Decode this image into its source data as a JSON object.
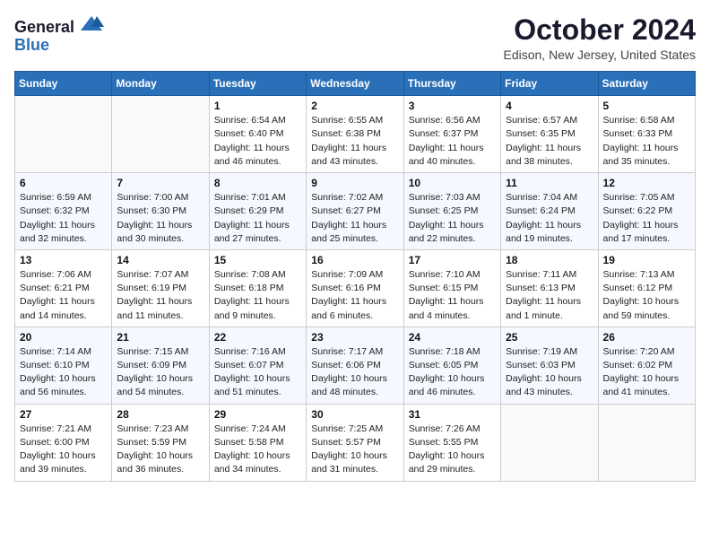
{
  "header": {
    "logo_general": "General",
    "logo_blue": "Blue",
    "month": "October 2024",
    "location": "Edison, New Jersey, United States"
  },
  "days_of_week": [
    "Sunday",
    "Monday",
    "Tuesday",
    "Wednesday",
    "Thursday",
    "Friday",
    "Saturday"
  ],
  "weeks": [
    [
      {
        "day": "",
        "detail": ""
      },
      {
        "day": "",
        "detail": ""
      },
      {
        "day": "1",
        "detail": "Sunrise: 6:54 AM\nSunset: 6:40 PM\nDaylight: 11 hours and 46 minutes."
      },
      {
        "day": "2",
        "detail": "Sunrise: 6:55 AM\nSunset: 6:38 PM\nDaylight: 11 hours and 43 minutes."
      },
      {
        "day": "3",
        "detail": "Sunrise: 6:56 AM\nSunset: 6:37 PM\nDaylight: 11 hours and 40 minutes."
      },
      {
        "day": "4",
        "detail": "Sunrise: 6:57 AM\nSunset: 6:35 PM\nDaylight: 11 hours and 38 minutes."
      },
      {
        "day": "5",
        "detail": "Sunrise: 6:58 AM\nSunset: 6:33 PM\nDaylight: 11 hours and 35 minutes."
      }
    ],
    [
      {
        "day": "6",
        "detail": "Sunrise: 6:59 AM\nSunset: 6:32 PM\nDaylight: 11 hours and 32 minutes."
      },
      {
        "day": "7",
        "detail": "Sunrise: 7:00 AM\nSunset: 6:30 PM\nDaylight: 11 hours and 30 minutes."
      },
      {
        "day": "8",
        "detail": "Sunrise: 7:01 AM\nSunset: 6:29 PM\nDaylight: 11 hours and 27 minutes."
      },
      {
        "day": "9",
        "detail": "Sunrise: 7:02 AM\nSunset: 6:27 PM\nDaylight: 11 hours and 25 minutes."
      },
      {
        "day": "10",
        "detail": "Sunrise: 7:03 AM\nSunset: 6:25 PM\nDaylight: 11 hours and 22 minutes."
      },
      {
        "day": "11",
        "detail": "Sunrise: 7:04 AM\nSunset: 6:24 PM\nDaylight: 11 hours and 19 minutes."
      },
      {
        "day": "12",
        "detail": "Sunrise: 7:05 AM\nSunset: 6:22 PM\nDaylight: 11 hours and 17 minutes."
      }
    ],
    [
      {
        "day": "13",
        "detail": "Sunrise: 7:06 AM\nSunset: 6:21 PM\nDaylight: 11 hours and 14 minutes."
      },
      {
        "day": "14",
        "detail": "Sunrise: 7:07 AM\nSunset: 6:19 PM\nDaylight: 11 hours and 11 minutes."
      },
      {
        "day": "15",
        "detail": "Sunrise: 7:08 AM\nSunset: 6:18 PM\nDaylight: 11 hours and 9 minutes."
      },
      {
        "day": "16",
        "detail": "Sunrise: 7:09 AM\nSunset: 6:16 PM\nDaylight: 11 hours and 6 minutes."
      },
      {
        "day": "17",
        "detail": "Sunrise: 7:10 AM\nSunset: 6:15 PM\nDaylight: 11 hours and 4 minutes."
      },
      {
        "day": "18",
        "detail": "Sunrise: 7:11 AM\nSunset: 6:13 PM\nDaylight: 11 hours and 1 minute."
      },
      {
        "day": "19",
        "detail": "Sunrise: 7:13 AM\nSunset: 6:12 PM\nDaylight: 10 hours and 59 minutes."
      }
    ],
    [
      {
        "day": "20",
        "detail": "Sunrise: 7:14 AM\nSunset: 6:10 PM\nDaylight: 10 hours and 56 minutes."
      },
      {
        "day": "21",
        "detail": "Sunrise: 7:15 AM\nSunset: 6:09 PM\nDaylight: 10 hours and 54 minutes."
      },
      {
        "day": "22",
        "detail": "Sunrise: 7:16 AM\nSunset: 6:07 PM\nDaylight: 10 hours and 51 minutes."
      },
      {
        "day": "23",
        "detail": "Sunrise: 7:17 AM\nSunset: 6:06 PM\nDaylight: 10 hours and 48 minutes."
      },
      {
        "day": "24",
        "detail": "Sunrise: 7:18 AM\nSunset: 6:05 PM\nDaylight: 10 hours and 46 minutes."
      },
      {
        "day": "25",
        "detail": "Sunrise: 7:19 AM\nSunset: 6:03 PM\nDaylight: 10 hours and 43 minutes."
      },
      {
        "day": "26",
        "detail": "Sunrise: 7:20 AM\nSunset: 6:02 PM\nDaylight: 10 hours and 41 minutes."
      }
    ],
    [
      {
        "day": "27",
        "detail": "Sunrise: 7:21 AM\nSunset: 6:00 PM\nDaylight: 10 hours and 39 minutes."
      },
      {
        "day": "28",
        "detail": "Sunrise: 7:23 AM\nSunset: 5:59 PM\nDaylight: 10 hours and 36 minutes."
      },
      {
        "day": "29",
        "detail": "Sunrise: 7:24 AM\nSunset: 5:58 PM\nDaylight: 10 hours and 34 minutes."
      },
      {
        "day": "30",
        "detail": "Sunrise: 7:25 AM\nSunset: 5:57 PM\nDaylight: 10 hours and 31 minutes."
      },
      {
        "day": "31",
        "detail": "Sunrise: 7:26 AM\nSunset: 5:55 PM\nDaylight: 10 hours and 29 minutes."
      },
      {
        "day": "",
        "detail": ""
      },
      {
        "day": "",
        "detail": ""
      }
    ]
  ]
}
